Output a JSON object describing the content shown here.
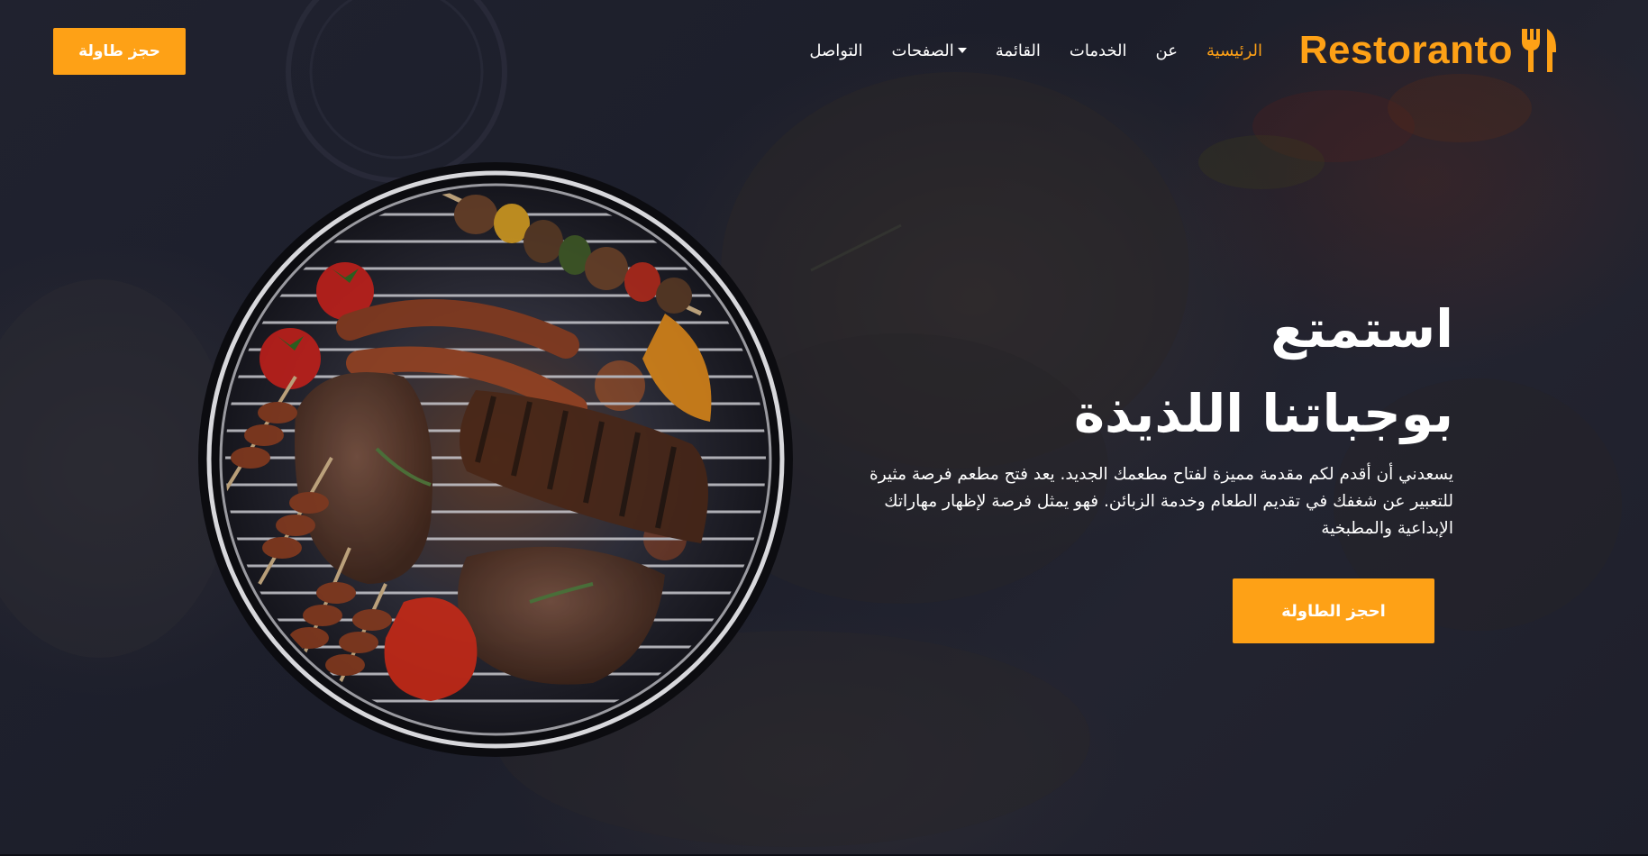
{
  "brand": {
    "name": "Restoranto",
    "icon": "fork-knife-icon"
  },
  "nav": {
    "items": [
      {
        "label": "الرئيسية",
        "active": true
      },
      {
        "label": "عن",
        "active": false
      },
      {
        "label": "الخدمات",
        "active": false
      },
      {
        "label": "القائمة",
        "active": false
      },
      {
        "label": "الصفحات",
        "active": false,
        "dropdown": true
      },
      {
        "label": "التواصل",
        "active": false
      }
    ],
    "book_button": "حجز طاولة"
  },
  "hero": {
    "title_line1": "استمتع",
    "title_line2": "بوجباتنا اللذيذة",
    "description": "يسعدني أن أقدم لكم مقدمة مميزة لفتاح مطعمك الجديد. يعد فتح مطعم فرصة مثيرة للتعبير عن شغفك في تقديم الطعام وخدمة الزبائن. فهو يمثل فرصة لإظهار مهاراتك الإبداعية والمطبخية",
    "cta": "احجز الطاولة",
    "image": "grilled-meat-bbq-image"
  },
  "colors": {
    "accent": "#fea116",
    "background": "#1b1d2b",
    "text": "#ffffff"
  }
}
